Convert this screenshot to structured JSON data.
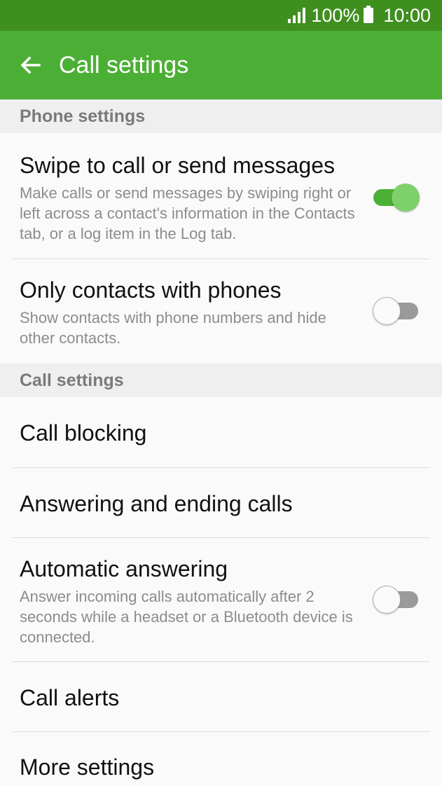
{
  "status_bar": {
    "battery_percent": "100%",
    "time": "10:00",
    "icons": [
      "signal-icon",
      "battery-icon"
    ]
  },
  "app_bar": {
    "title": "Call settings",
    "back_icon": "arrow-left-icon"
  },
  "sections": {
    "phone_settings": "Phone settings",
    "call_settings": "Call settings"
  },
  "items": {
    "swipe": {
      "title": "Swipe to call or send messages",
      "description": "Make calls or send messages by swiping right or left across a contact's information in the Contacts tab, or a log item in the Log tab.",
      "enabled": true
    },
    "only_contacts": {
      "title": "Only contacts with phones",
      "description": "Show contacts with phone numbers and hide other contacts.",
      "enabled": false
    },
    "call_blocking": {
      "title": "Call blocking"
    },
    "answering": {
      "title": "Answering and ending calls"
    },
    "auto_answer": {
      "title": "Automatic answering",
      "description": "Answer incoming calls automatically after 2 seconds while a headset or a Bluetooth device is connected.",
      "enabled": false
    },
    "call_alerts": {
      "title": "Call alerts"
    },
    "more_settings": {
      "title": "More settings"
    }
  },
  "colors": {
    "status_bar": "#3f8f1f",
    "app_bar": "#4caf35",
    "toggle_on_track": "#4caf35",
    "toggle_on_thumb": "#7ed06a",
    "toggle_off_track": "#9a9a9a"
  }
}
